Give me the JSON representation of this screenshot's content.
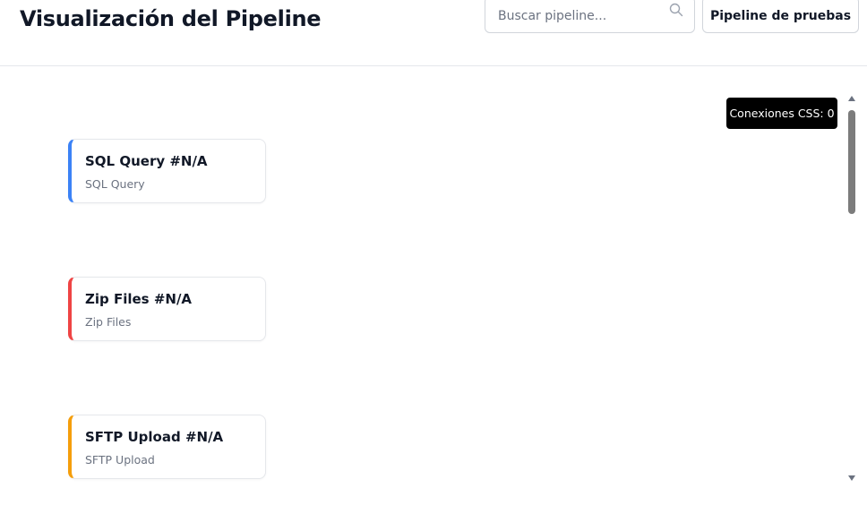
{
  "header": {
    "title": "Visualización del Pipeline",
    "search": {
      "placeholder": "Buscar pipeline...",
      "value": ""
    },
    "test_button_label": "Pipeline de pruebas"
  },
  "canvas": {
    "connections_badge": "Conexiones CSS: 0",
    "nodes": [
      {
        "title": "SQL Query #N/A",
        "subtitle": "SQL Query",
        "accent": "#3b82f6"
      },
      {
        "title": "Zip Files #N/A",
        "subtitle": "Zip Files",
        "accent": "#ef4444"
      },
      {
        "title": "SFTP Upload #N/A",
        "subtitle": "SFTP Upload",
        "accent": "#f59e0b"
      }
    ]
  },
  "icons": {
    "search": "search-icon"
  }
}
